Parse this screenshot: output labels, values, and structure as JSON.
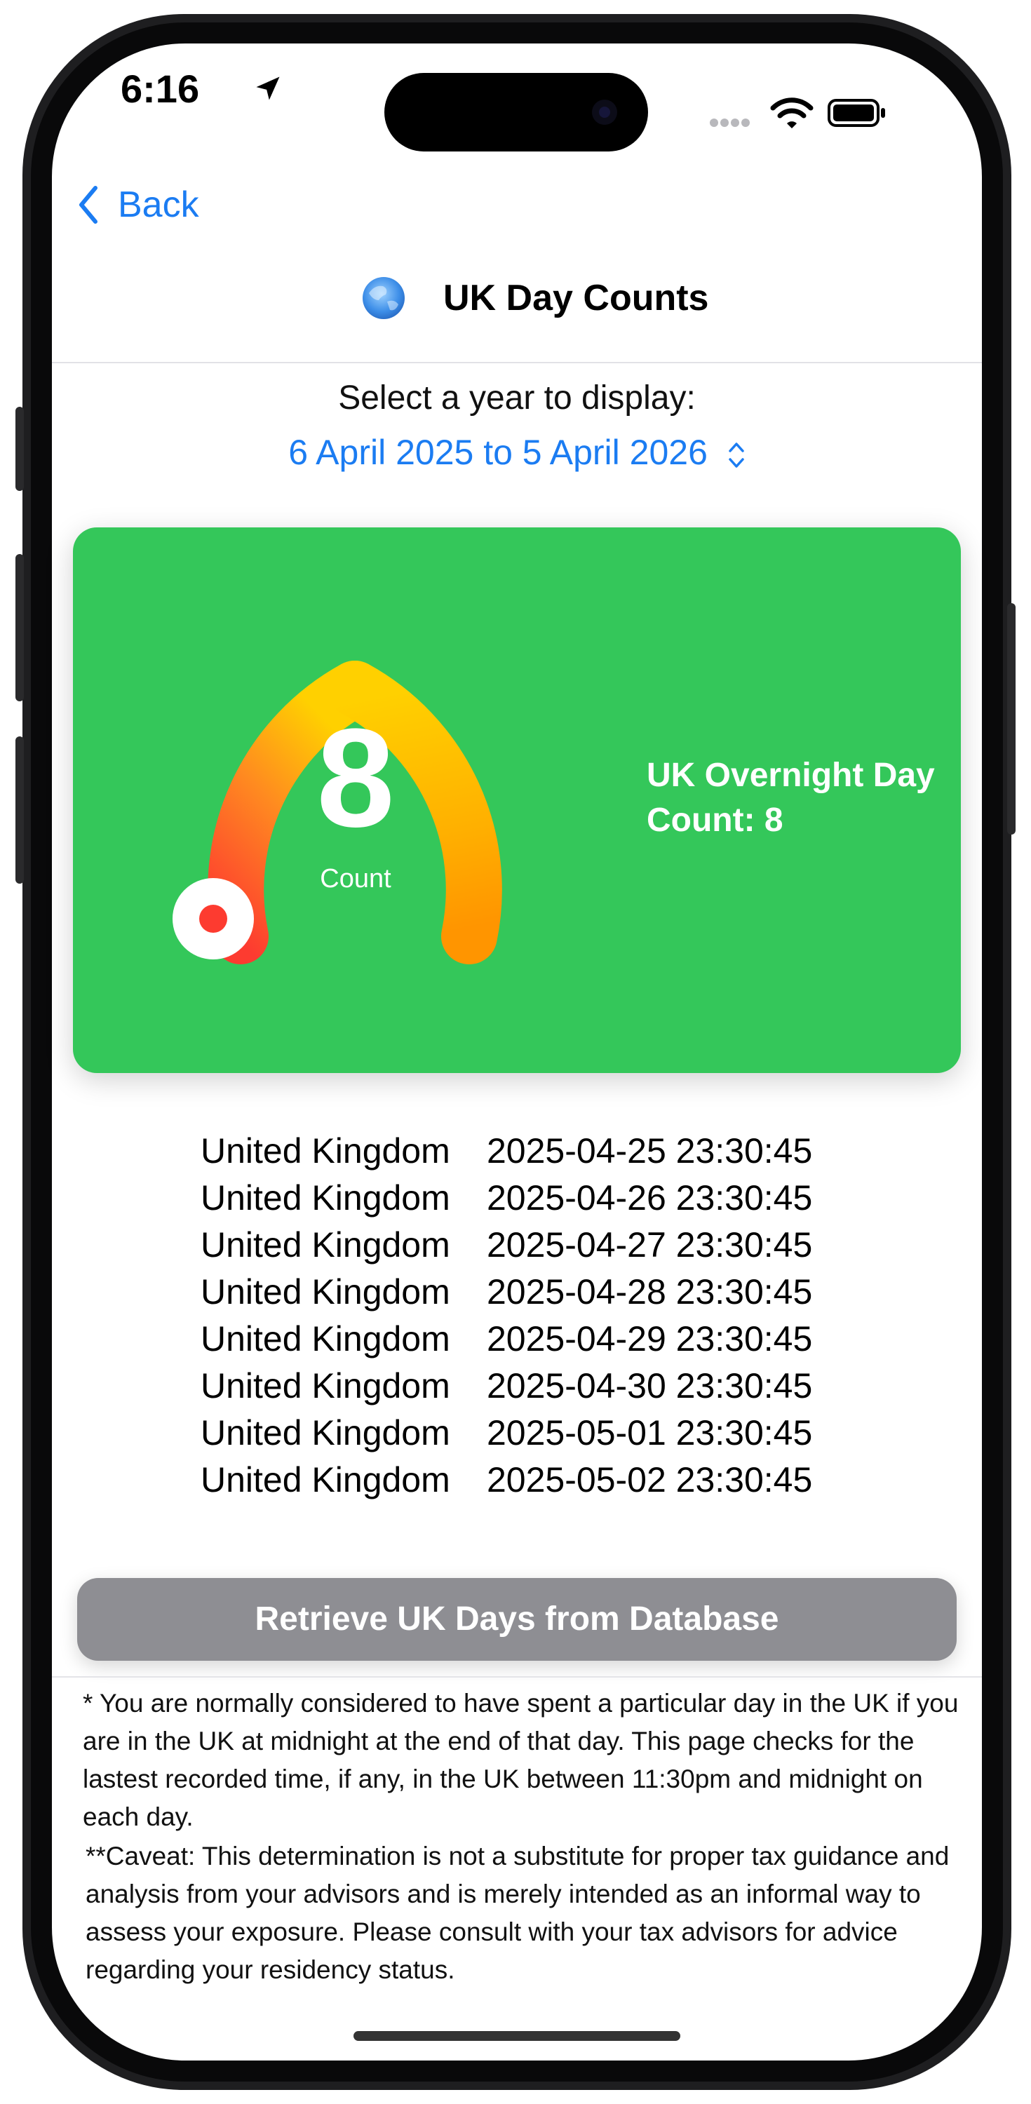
{
  "status_bar": {
    "time": "6:16"
  },
  "nav": {
    "back_label": "Back",
    "title": "UK Day Counts"
  },
  "year_selector": {
    "prompt": "Select a year to display:",
    "selected": "6 April 2025 to 5 April 2026"
  },
  "gauge": {
    "value": "8",
    "label": "Count",
    "summary": "UK Overnight Day Count: 8",
    "colors": {
      "card": "#34c75a",
      "arc_start": "#fd3b30",
      "arc_mid": "#ffd000",
      "arc_end": "#ff9500"
    }
  },
  "days": [
    {
      "country": "United Kingdom",
      "time": "2025-04-25 23:30:45"
    },
    {
      "country": "United Kingdom",
      "time": "2025-04-26 23:30:45"
    },
    {
      "country": "United Kingdom",
      "time": "2025-04-27 23:30:45"
    },
    {
      "country": "United Kingdom",
      "time": "2025-04-28 23:30:45"
    },
    {
      "country": "United Kingdom",
      "time": "2025-04-29 23:30:45"
    },
    {
      "country": "United Kingdom",
      "time": "2025-04-30 23:30:45"
    },
    {
      "country": "United Kingdom",
      "time": "2025-05-01 23:30:45"
    },
    {
      "country": "United Kingdom",
      "time": "2025-05-02 23:30:45"
    }
  ],
  "retrieve_button": "Retrieve UK Days from Database",
  "footnote": {
    "rule": "* You are normally considered to have spent a particular day in the UK if you are in the UK at midnight at the end of that day.  This page checks for the lastest recorded time, if any, in the UK between 11:30pm and midnight on each day.",
    "caveat": "**Caveat:  This determination is not a substitute for proper tax guidance and analysis from your advisors and is merely intended as an informal way to assess your exposure.  Please consult with your tax advisors for advice regarding your residency status."
  },
  "icons": {
    "back": "chevron-left-icon",
    "app": "globe-icon",
    "picker": "chevron-up-down-icon",
    "location": "location-arrow-icon",
    "wifi": "wifi-icon",
    "battery": "battery-icon"
  }
}
